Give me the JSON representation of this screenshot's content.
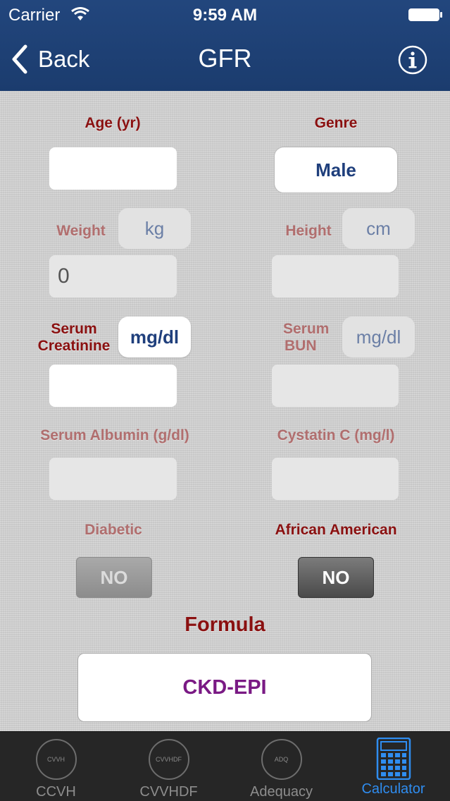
{
  "status_bar": {
    "carrier": "Carrier",
    "time": "9:59 AM"
  },
  "nav": {
    "back_label": "Back",
    "title": "GFR"
  },
  "form": {
    "age": {
      "label": "Age (yr)",
      "value": ""
    },
    "genre": {
      "label": "Genre",
      "value": "Male"
    },
    "weight": {
      "label": "Weight",
      "unit": "kg",
      "value": "0"
    },
    "height": {
      "label": "Height",
      "unit": "cm",
      "value": ""
    },
    "serum_creatinine": {
      "label_line1": "Serum",
      "label_line2": "Creatinine",
      "unit": "mg/dl",
      "value": ""
    },
    "serum_bun": {
      "label_line1": "Serum",
      "label_line2": "BUN",
      "unit": "mg/dl",
      "value": ""
    },
    "serum_albumin": {
      "label": "Serum Albumin (g/dl)",
      "value": ""
    },
    "cystatin_c": {
      "label": "Cystatin C (mg/l)",
      "value": ""
    },
    "diabetic": {
      "label": "Diabetic",
      "value": "NO"
    },
    "african_american": {
      "label": "African American",
      "value": "NO"
    },
    "formula": {
      "label": "Formula",
      "value": "CKD-EPI"
    }
  },
  "tabs": [
    {
      "icon_text": "CVVH",
      "label": "CCVH"
    },
    {
      "icon_text": "CVVHDF",
      "label": "CVVHDF"
    },
    {
      "icon_text": "ADQ",
      "label": "Adequacy"
    },
    {
      "label": "Calculator",
      "active": true
    }
  ],
  "colors": {
    "nav_bar": "#1b3c6e",
    "label_red": "#8a1010",
    "formula_purple": "#7a1a84",
    "tab_active": "#2f8df0"
  }
}
